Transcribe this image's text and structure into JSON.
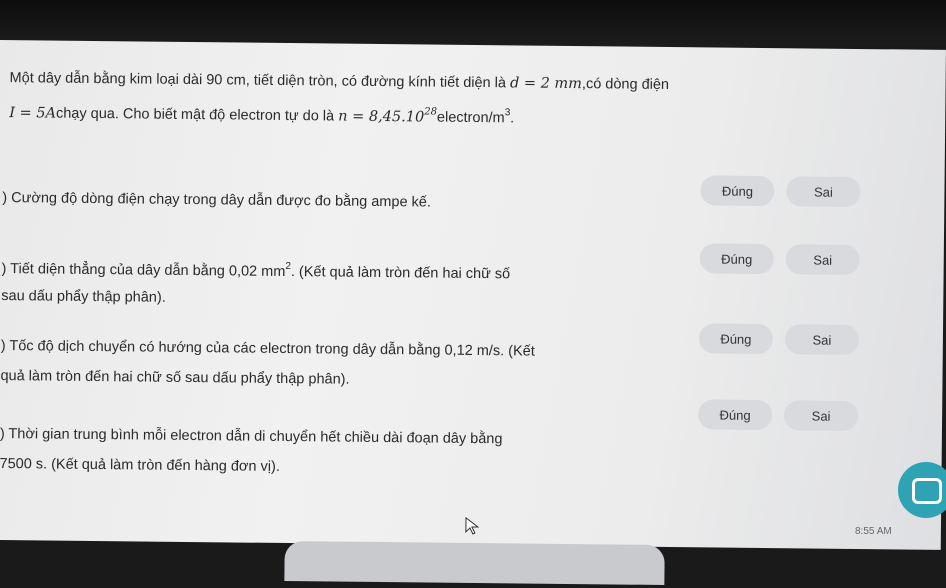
{
  "question": {
    "line1_text": "Một dây dẫn bằng kim loại dài 90 cm, tiết diện tròn, có đường kính tiết diện là ",
    "line1_math": "d = 2 mm",
    "line1_tail": ",có dòng điện",
    "line2_math_I": "I = 5A",
    "line2_text": "chạy qua. Cho biết mật độ electron tự do là ",
    "line2_math_n": "n = 8,45.10",
    "line2_exp": "28",
    "line2_unit": "electron/m",
    "line2_unit_exp": "3",
    "line2_end": "."
  },
  "items": [
    {
      "text": ") Cường độ dòng điện chạy trong dây dẫn được đo bằng ampe kế.",
      "true_label": "Đúng",
      "false_label": "Sai"
    },
    {
      "text_a": ") Tiết diện thẳng của dây dẫn bằng 0,02 mm",
      "text_a_exp": "2",
      "text_a_tail": ". (Kết quả làm tròn đến hai chữ số",
      "text_b": "sau dấu phẩy thập phân).",
      "true_label": "Đúng",
      "false_label": "Sai"
    },
    {
      "text_a": ") Tốc độ dịch chuyển có hướng của các electron trong dây dẫn bằng 0,12 m/s. (Kết",
      "text_b": "quả làm tròn đến hai chữ số sau dấu phẩy thập phân).",
      "true_label": "Đúng",
      "false_label": "Sai"
    },
    {
      "text_a": ") Thời gian trung bình mỗi electron dẫn di chuyển hết chiều dài đoạn dây bằng",
      "text_b": "7500 s. (Kết quả làm tròn đến hàng đơn vị).",
      "true_label": "Đúng",
      "false_label": "Sai"
    }
  ],
  "status": {
    "time": "8:55 AM"
  },
  "colors": {
    "button_bg": "#d9dadd",
    "fab": "#2fa3b3",
    "text": "#2a2a2a"
  }
}
